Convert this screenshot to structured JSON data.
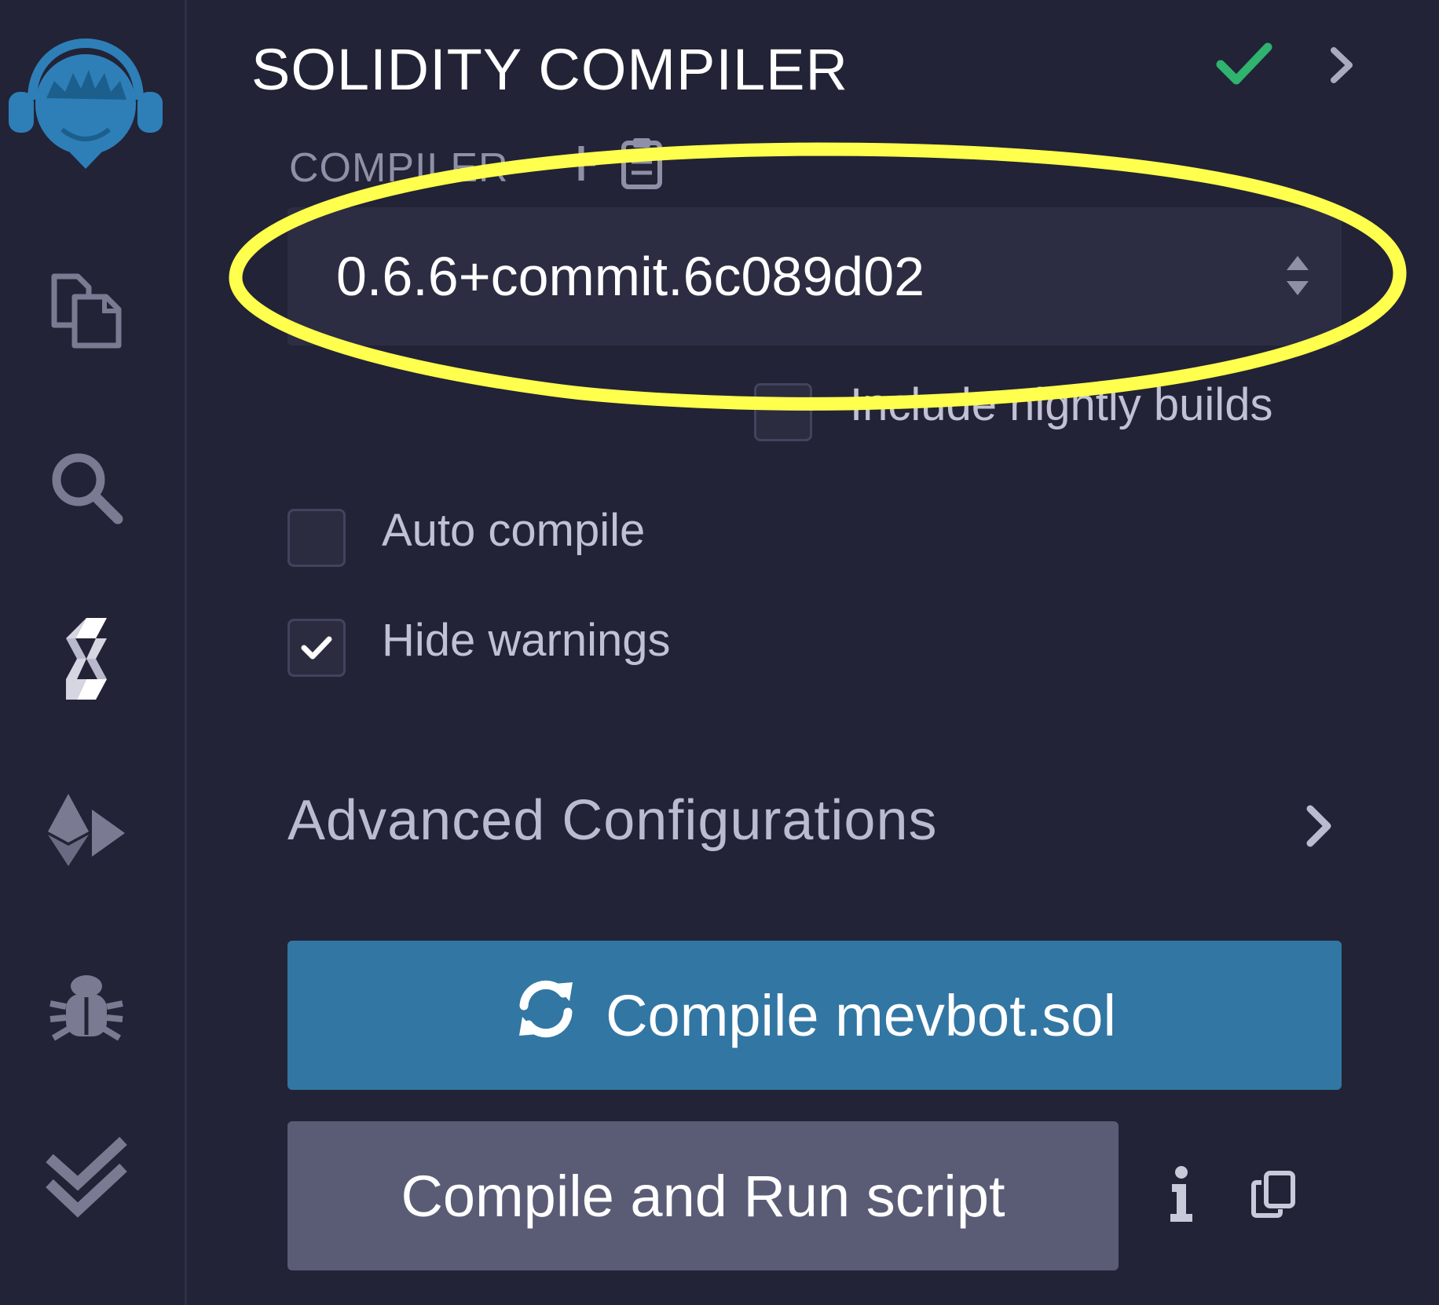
{
  "iconbar": {
    "items": [
      {
        "name": "remix-logo-icon"
      },
      {
        "name": "file-explorer-icon"
      },
      {
        "name": "search-icon"
      },
      {
        "name": "solidity-compiler-icon"
      },
      {
        "name": "deploy-run-icon"
      },
      {
        "name": "debugger-icon"
      },
      {
        "name": "testing-icon"
      }
    ]
  },
  "panel": {
    "title": "SOLIDITY COMPILER",
    "compiler_label": "COMPILER",
    "compiler_version": "0.6.6+commit.6c089d02",
    "nightly_label": "Include nightly builds",
    "nightly_checked": false,
    "auto_compile_label": "Auto compile",
    "auto_compile_checked": false,
    "hide_warnings_label": "Hide warnings",
    "hide_warnings_checked": true,
    "advanced_label": "Advanced Configurations",
    "compile_button": "Compile mevbot.sol",
    "run_script_button": "Compile and Run script"
  },
  "colors": {
    "background": "#222336",
    "accent_blue": "#3276a3",
    "secondary_button": "#5a5c76",
    "success_check": "#2fb36f",
    "highlight_yellow": "#ffff4d",
    "logo_blue": "#2e7fb8"
  }
}
